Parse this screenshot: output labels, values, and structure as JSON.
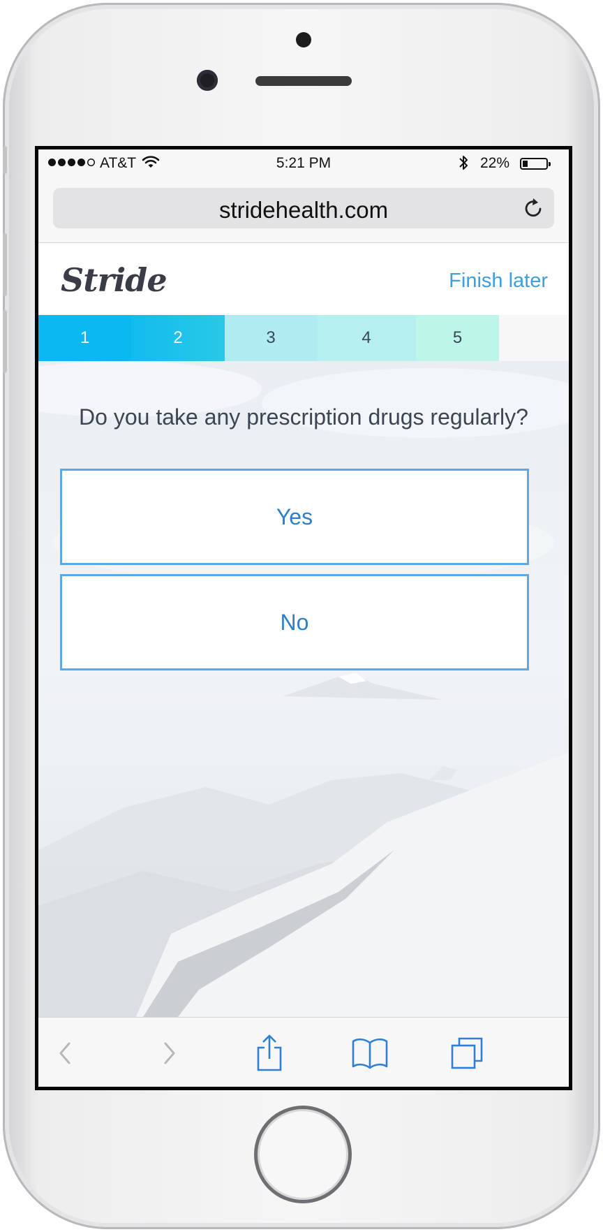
{
  "status_bar": {
    "carrier": "AT&T",
    "time": "5:21 PM",
    "battery_percent": "22%",
    "battery_level": 0.22,
    "signal_bars_filled": 4,
    "signal_bars_total": 5
  },
  "browser": {
    "url": "stridehealth.com"
  },
  "header": {
    "logo_text": "Stride",
    "finish_label": "Finish later"
  },
  "progress": {
    "current_step": 2,
    "steps": [
      "1",
      "2",
      "3",
      "4",
      "5"
    ]
  },
  "question": {
    "text": "Do you take any prescription drugs regularly?",
    "options": [
      "Yes",
      "No"
    ]
  },
  "colors": {
    "accent": "#3b9fe0",
    "option_border": "#5ea9e4",
    "option_text": "#2f7fc9",
    "step_done_start": "#06b6f0",
    "step_done_end": "#29c8e6",
    "step_todo_start": "#aeeaf1",
    "step_todo_end": "#bdf5e8",
    "safari_blue": "#2f7fd6"
  },
  "icons": {
    "reload": "reload-icon",
    "back": "chevron-left-icon",
    "forward": "chevron-right-icon",
    "share": "share-icon",
    "bookmarks": "book-icon",
    "tabs": "tabs-icon"
  }
}
